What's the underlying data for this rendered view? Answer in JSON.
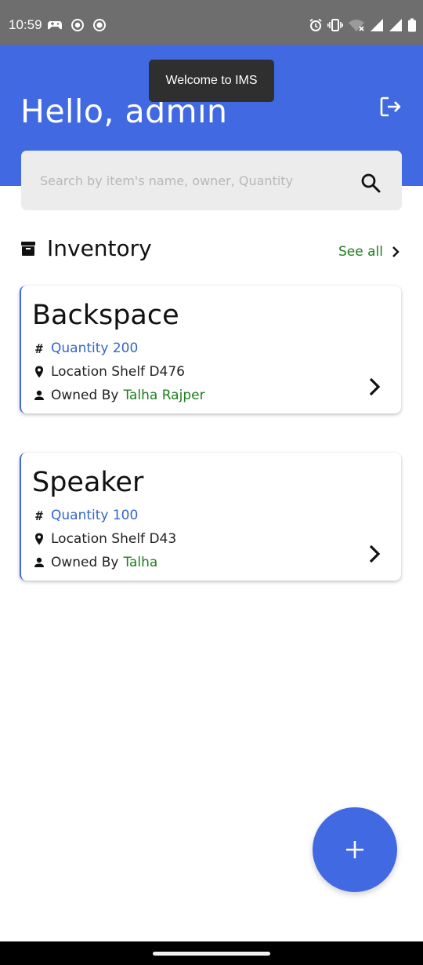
{
  "status_bar": {
    "time": "10:59",
    "left_icons": [
      "game-controller-icon",
      "record-icon",
      "screen-record-icon"
    ],
    "right_icons": [
      "alarm-icon",
      "vibrate-icon",
      "wifi-off-icon",
      "signal-icon",
      "signal-icon",
      "battery-icon"
    ]
  },
  "header": {
    "greeting": "Hello, admin",
    "logout_icon": "logout-icon",
    "color": "#4169e1"
  },
  "toast": {
    "message": "Welcome to IMS"
  },
  "search": {
    "placeholder": "Search by item's name, owner, Quantity",
    "value": "",
    "icon": "search-icon"
  },
  "inventory": {
    "title": "Inventory",
    "icon": "archive-box-icon",
    "see_all_label": "See all",
    "items": [
      {
        "name": "Backspace",
        "quantity_text": "Quantity 200",
        "location_text": "Location Shelf D476",
        "owned_by_label": "Owned By",
        "owner": "Talha Rajper"
      },
      {
        "name": "Speaker",
        "quantity_text": "Quantity 100",
        "location_text": "Location Shelf D43",
        "owned_by_label": "Owned By",
        "owner": "Talha"
      }
    ]
  },
  "fab": {
    "icon": "plus-icon"
  },
  "colors": {
    "primary": "#4169e1",
    "quantity": "#3566c9",
    "owner": "#1e7d1e",
    "status_bar": "#6e6e6e"
  }
}
